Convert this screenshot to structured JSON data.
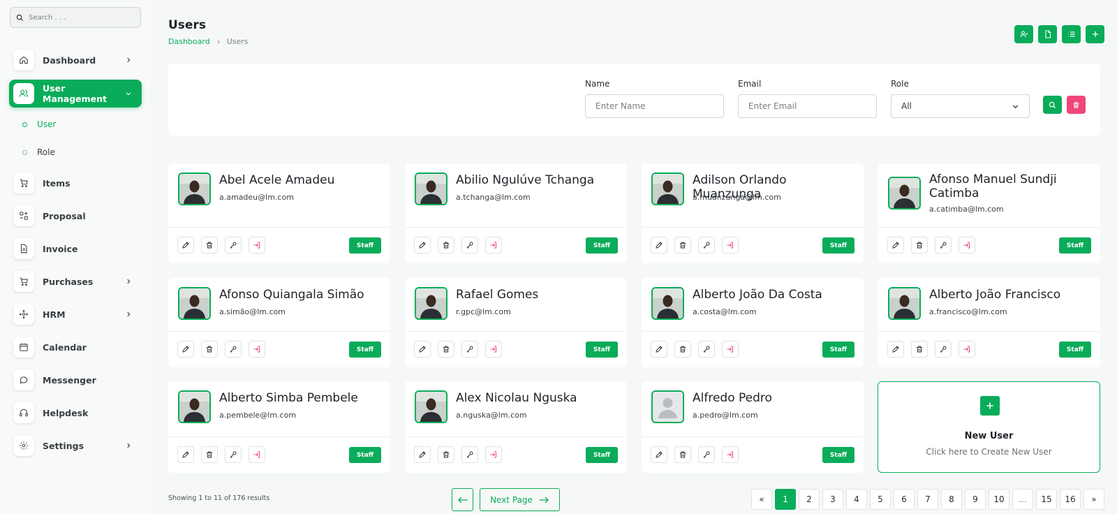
{
  "search": {
    "placeholder": "Search . . ."
  },
  "sidebar": {
    "items": [
      {
        "label": "Dashboard",
        "icon": "home-icon"
      },
      {
        "label": "User Management",
        "icon": "users-icon"
      },
      {
        "label": "Items",
        "icon": "cart-icon"
      },
      {
        "label": "Proposal",
        "icon": "proposal-icon"
      },
      {
        "label": "Invoice",
        "icon": "document-icon"
      },
      {
        "label": "Purchases",
        "icon": "cart-icon"
      },
      {
        "label": "HRM",
        "icon": "hrm-icon"
      },
      {
        "label": "Calendar",
        "icon": "calendar-icon"
      },
      {
        "label": "Messenger",
        "icon": "chat-icon"
      },
      {
        "label": "Helpdesk",
        "icon": "headphones-icon"
      },
      {
        "label": "Settings",
        "icon": "gear-icon"
      }
    ],
    "subitems": [
      {
        "label": "User"
      },
      {
        "label": "Role"
      }
    ]
  },
  "header": {
    "title": "Users",
    "breadcrumb": {
      "home": "Dashboard",
      "current": "Users"
    }
  },
  "filter": {
    "name_label": "Name",
    "name_placeholder": "Enter Name",
    "email_label": "Email",
    "email_placeholder": "Enter Email",
    "role_label": "Role",
    "role_value": "All"
  },
  "users": [
    {
      "name": "Abel Acele Amadeu",
      "email": "a.amadeu@lm.com",
      "role": "Staff",
      "photo": true
    },
    {
      "name": "Abilio Ngulúve Tchanga",
      "email": "a.tchanga@lm.com",
      "role": "Staff",
      "photo": true
    },
    {
      "name": "Adilson Orlando Muanzunga",
      "email": "a.muanzunga@lm.com",
      "role": "Staff",
      "photo": true
    },
    {
      "name": "Afonso Manuel Sundji Catimba",
      "email": "a.catimba@lm.com",
      "role": "Staff",
      "photo": true
    },
    {
      "name": "Afonso Quiangala Simão",
      "email": "a.simão@lm.com",
      "role": "Staff",
      "photo": true
    },
    {
      "name": "Rafael Gomes",
      "email": "r.gpc@lm.com",
      "role": "Staff",
      "photo": true
    },
    {
      "name": "Alberto João Da Costa",
      "email": "a.costa@lm.com",
      "role": "Staff",
      "photo": true
    },
    {
      "name": "Alberto João Francisco",
      "email": "a.francisco@lm.com",
      "role": "Staff",
      "photo": true
    },
    {
      "name": "Alberto Simba Pembele",
      "email": "a.pembele@lm.com",
      "role": "Staff",
      "photo": true
    },
    {
      "name": "Alex Nicolau Nguska",
      "email": "a.nguska@lm.com",
      "role": "Staff",
      "photo": true
    },
    {
      "name": "Alfredo Pedro",
      "email": "a.pedro@lm.com",
      "role": "Staff",
      "photo": false
    }
  ],
  "new_user": {
    "title": "New User",
    "subtitle": "Click here to Create New User"
  },
  "pagination": {
    "showing": "Showing 1 to 11 of 176 results",
    "next_label": "Next Page",
    "first_symbol": "«",
    "last_symbol": "»",
    "pages": [
      "1",
      "2",
      "3",
      "4",
      "5",
      "6",
      "7",
      "8",
      "9",
      "10",
      "...",
      "15",
      "16"
    ],
    "current": "1"
  },
  "colors": {
    "accent": "#0aac5a",
    "danger": "#f0457a"
  }
}
